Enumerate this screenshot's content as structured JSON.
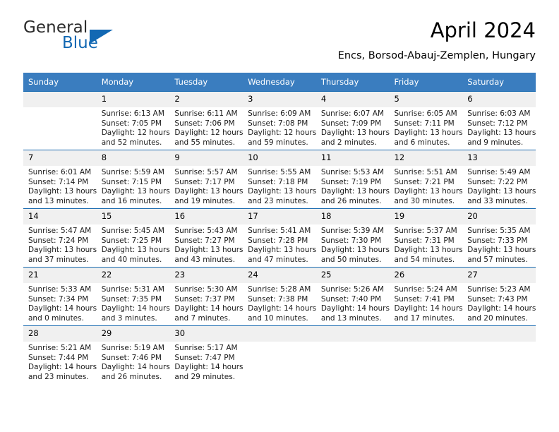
{
  "brand": {
    "name_part1": "General",
    "name_part2": "Blue",
    "logo_icon": "triangle-logo-icon",
    "accent_color": "#1268b3"
  },
  "header": {
    "title": "April 2024",
    "subtitle": "Encs, Borsod-Abauj-Zemplen, Hungary"
  },
  "theme": {
    "header_row_bg": "#3a7dbf",
    "row_border": "#1a6bb0",
    "daynum_bg": "#f0f0f0"
  },
  "calendar": {
    "weekday_headers": [
      "Sunday",
      "Monday",
      "Tuesday",
      "Wednesday",
      "Thursday",
      "Friday",
      "Saturday"
    ],
    "weeks": [
      [
        {
          "day": "",
          "lines": []
        },
        {
          "day": "1",
          "lines": [
            "Sunrise: 6:13 AM",
            "Sunset: 7:05 PM",
            "Daylight: 12 hours",
            "and 52 minutes."
          ]
        },
        {
          "day": "2",
          "lines": [
            "Sunrise: 6:11 AM",
            "Sunset: 7:06 PM",
            "Daylight: 12 hours",
            "and 55 minutes."
          ]
        },
        {
          "day": "3",
          "lines": [
            "Sunrise: 6:09 AM",
            "Sunset: 7:08 PM",
            "Daylight: 12 hours",
            "and 59 minutes."
          ]
        },
        {
          "day": "4",
          "lines": [
            "Sunrise: 6:07 AM",
            "Sunset: 7:09 PM",
            "Daylight: 13 hours",
            "and 2 minutes."
          ]
        },
        {
          "day": "5",
          "lines": [
            "Sunrise: 6:05 AM",
            "Sunset: 7:11 PM",
            "Daylight: 13 hours",
            "and 6 minutes."
          ]
        },
        {
          "day": "6",
          "lines": [
            "Sunrise: 6:03 AM",
            "Sunset: 7:12 PM",
            "Daylight: 13 hours",
            "and 9 minutes."
          ]
        }
      ],
      [
        {
          "day": "7",
          "lines": [
            "Sunrise: 6:01 AM",
            "Sunset: 7:14 PM",
            "Daylight: 13 hours",
            "and 13 minutes."
          ]
        },
        {
          "day": "8",
          "lines": [
            "Sunrise: 5:59 AM",
            "Sunset: 7:15 PM",
            "Daylight: 13 hours",
            "and 16 minutes."
          ]
        },
        {
          "day": "9",
          "lines": [
            "Sunrise: 5:57 AM",
            "Sunset: 7:17 PM",
            "Daylight: 13 hours",
            "and 19 minutes."
          ]
        },
        {
          "day": "10",
          "lines": [
            "Sunrise: 5:55 AM",
            "Sunset: 7:18 PM",
            "Daylight: 13 hours",
            "and 23 minutes."
          ]
        },
        {
          "day": "11",
          "lines": [
            "Sunrise: 5:53 AM",
            "Sunset: 7:19 PM",
            "Daylight: 13 hours",
            "and 26 minutes."
          ]
        },
        {
          "day": "12",
          "lines": [
            "Sunrise: 5:51 AM",
            "Sunset: 7:21 PM",
            "Daylight: 13 hours",
            "and 30 minutes."
          ]
        },
        {
          "day": "13",
          "lines": [
            "Sunrise: 5:49 AM",
            "Sunset: 7:22 PM",
            "Daylight: 13 hours",
            "and 33 minutes."
          ]
        }
      ],
      [
        {
          "day": "14",
          "lines": [
            "Sunrise: 5:47 AM",
            "Sunset: 7:24 PM",
            "Daylight: 13 hours",
            "and 37 minutes."
          ]
        },
        {
          "day": "15",
          "lines": [
            "Sunrise: 5:45 AM",
            "Sunset: 7:25 PM",
            "Daylight: 13 hours",
            "and 40 minutes."
          ]
        },
        {
          "day": "16",
          "lines": [
            "Sunrise: 5:43 AM",
            "Sunset: 7:27 PM",
            "Daylight: 13 hours",
            "and 43 minutes."
          ]
        },
        {
          "day": "17",
          "lines": [
            "Sunrise: 5:41 AM",
            "Sunset: 7:28 PM",
            "Daylight: 13 hours",
            "and 47 minutes."
          ]
        },
        {
          "day": "18",
          "lines": [
            "Sunrise: 5:39 AM",
            "Sunset: 7:30 PM",
            "Daylight: 13 hours",
            "and 50 minutes."
          ]
        },
        {
          "day": "19",
          "lines": [
            "Sunrise: 5:37 AM",
            "Sunset: 7:31 PM",
            "Daylight: 13 hours",
            "and 54 minutes."
          ]
        },
        {
          "day": "20",
          "lines": [
            "Sunrise: 5:35 AM",
            "Sunset: 7:33 PM",
            "Daylight: 13 hours",
            "and 57 minutes."
          ]
        }
      ],
      [
        {
          "day": "21",
          "lines": [
            "Sunrise: 5:33 AM",
            "Sunset: 7:34 PM",
            "Daylight: 14 hours",
            "and 0 minutes."
          ]
        },
        {
          "day": "22",
          "lines": [
            "Sunrise: 5:31 AM",
            "Sunset: 7:35 PM",
            "Daylight: 14 hours",
            "and 3 minutes."
          ]
        },
        {
          "day": "23",
          "lines": [
            "Sunrise: 5:30 AM",
            "Sunset: 7:37 PM",
            "Daylight: 14 hours",
            "and 7 minutes."
          ]
        },
        {
          "day": "24",
          "lines": [
            "Sunrise: 5:28 AM",
            "Sunset: 7:38 PM",
            "Daylight: 14 hours",
            "and 10 minutes."
          ]
        },
        {
          "day": "25",
          "lines": [
            "Sunrise: 5:26 AM",
            "Sunset: 7:40 PM",
            "Daylight: 14 hours",
            "and 13 minutes."
          ]
        },
        {
          "day": "26",
          "lines": [
            "Sunrise: 5:24 AM",
            "Sunset: 7:41 PM",
            "Daylight: 14 hours",
            "and 17 minutes."
          ]
        },
        {
          "day": "27",
          "lines": [
            "Sunrise: 5:23 AM",
            "Sunset: 7:43 PM",
            "Daylight: 14 hours",
            "and 20 minutes."
          ]
        }
      ],
      [
        {
          "day": "28",
          "lines": [
            "Sunrise: 5:21 AM",
            "Sunset: 7:44 PM",
            "Daylight: 14 hours",
            "and 23 minutes."
          ]
        },
        {
          "day": "29",
          "lines": [
            "Sunrise: 5:19 AM",
            "Sunset: 7:46 PM",
            "Daylight: 14 hours",
            "and 26 minutes."
          ]
        },
        {
          "day": "30",
          "lines": [
            "Sunrise: 5:17 AM",
            "Sunset: 7:47 PM",
            "Daylight: 14 hours",
            "and 29 minutes."
          ]
        },
        {
          "day": "",
          "lines": []
        },
        {
          "day": "",
          "lines": []
        },
        {
          "day": "",
          "lines": []
        },
        {
          "day": "",
          "lines": []
        }
      ]
    ]
  }
}
